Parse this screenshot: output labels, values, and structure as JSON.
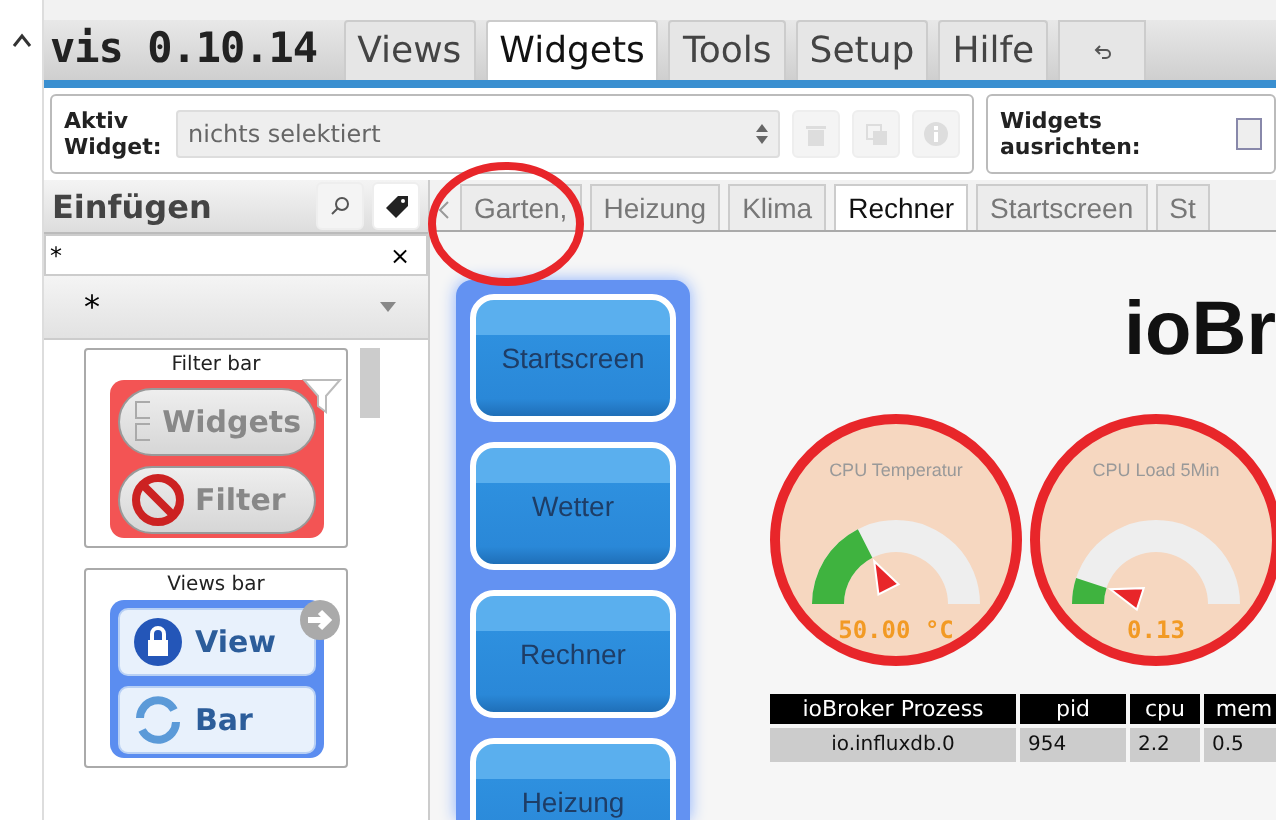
{
  "app": {
    "title": "vis 0.10.14"
  },
  "menu_tabs": [
    {
      "label": "Views",
      "selected": false
    },
    {
      "label": "Widgets",
      "selected": true
    },
    {
      "label": "Tools",
      "selected": false
    },
    {
      "label": "Setup",
      "selected": false
    },
    {
      "label": "Hilfe",
      "selected": false
    }
  ],
  "toolbar": {
    "active_widget_label": "Aktiv Widget:",
    "widget_select": "nichts selektiert",
    "align_label": "Widgets ausrichten:"
  },
  "sidebar": {
    "title": "Einfügen",
    "filter_value": "*",
    "clear_symbol": "×",
    "set_value": "*",
    "widgets": [
      {
        "title": "Filter bar",
        "kind": "filter",
        "buttons": [
          "Widgets",
          "Filter"
        ]
      },
      {
        "title": "Views bar",
        "kind": "views",
        "buttons": [
          "View",
          "Bar"
        ]
      }
    ]
  },
  "view_tabs": [
    {
      "label": "Garten,",
      "selected": false
    },
    {
      "label": "Heizung",
      "selected": false
    },
    {
      "label": "Klima",
      "selected": false
    },
    {
      "label": "Rechner",
      "selected": true
    },
    {
      "label": "Startscreen",
      "selected": false
    },
    {
      "label": "St",
      "selected": false
    }
  ],
  "canvas": {
    "nav_buttons": [
      "Startscreen",
      "Wetter",
      "Rechner",
      "Heizung"
    ],
    "heading": "ioBr",
    "gauges": [
      {
        "title": "CPU Temperatur",
        "reading": "50.00 °C",
        "level": 0.35
      },
      {
        "title": "CPU Load 5Min",
        "reading": "0.13",
        "level": 0.1
      }
    ],
    "table": {
      "columns": [
        "ioBroker Prozess",
        "pid",
        "cpu",
        "mem"
      ],
      "rows": [
        [
          "io.influxdb.0",
          "954",
          "2.2",
          "0.5"
        ]
      ]
    }
  }
}
